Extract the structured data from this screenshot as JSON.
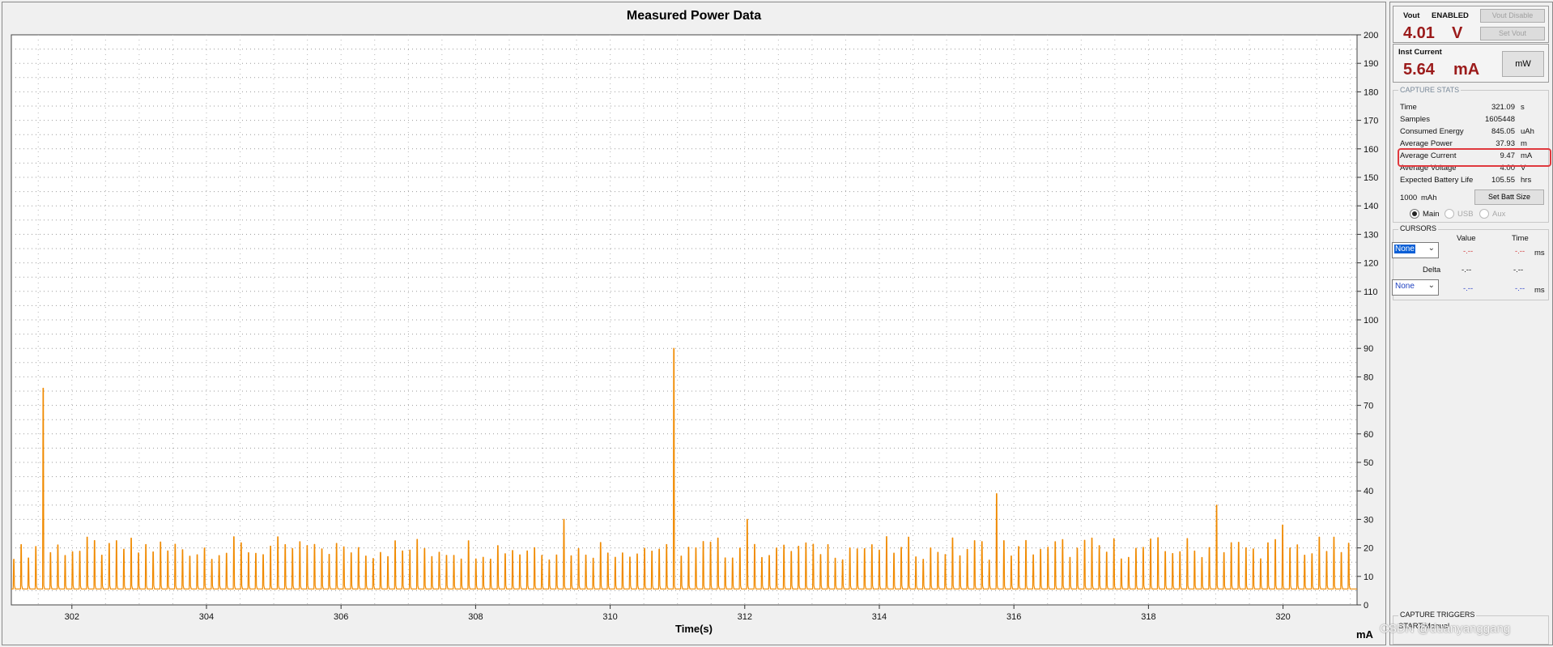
{
  "chart": {
    "title": "Measured Power Data",
    "xlabel": "Time(s)",
    "unit_label": "mA"
  },
  "chart_data": {
    "type": "line",
    "title": "Measured Power Data",
    "xlabel": "Time(s)",
    "ylabel": "mA",
    "xlim": [
      301.1,
      321.1
    ],
    "ylim": [
      0,
      200
    ],
    "x_ticks": [
      302,
      304,
      306,
      308,
      310,
      312,
      314,
      316,
      318,
      320
    ],
    "y_ticks": [
      0,
      10,
      20,
      30,
      40,
      50,
      60,
      70,
      80,
      90,
      100,
      110,
      120,
      130,
      140,
      150,
      160,
      170,
      180,
      190,
      200
    ],
    "grid": true,
    "series": [
      {
        "color": "#f08a00",
        "baseline": 5.6,
        "pulse_period_s": 0.109,
        "typical_peak": 22,
        "spikes": [
          {
            "x": 301.6,
            "y": 76
          },
          {
            "x": 309.3,
            "y": 30
          },
          {
            "x": 311.0,
            "y": 90
          },
          {
            "x": 312.0,
            "y": 30
          },
          {
            "x": 315.7,
            "y": 39
          },
          {
            "x": 319.0,
            "y": 35
          },
          {
            "x": 320.0,
            "y": 28
          }
        ]
      }
    ]
  },
  "panel": {
    "vout_label": "Vout",
    "vout_state": "ENABLED",
    "vout_disable_btn": "Vout Disable",
    "set_vout_btn": "Set Vout",
    "vout_value": "4.01",
    "vout_unit": "V",
    "inst_label": "Inst Current",
    "inst_value": "5.64",
    "inst_unit": "mA",
    "mw_btn": "mW",
    "capture_stats_title": "CAPTURE STATS",
    "stats": [
      {
        "label": "Time",
        "value": "321.09",
        "unit": "s"
      },
      {
        "label": "Samples",
        "value": "1605448",
        "unit": ""
      },
      {
        "label": "Consumed Energy",
        "value": "845.05",
        "unit": "uAh"
      },
      {
        "label": "Average Power",
        "value": "37.93",
        "unit": "m"
      },
      {
        "label": "Average Current",
        "value": "9.47",
        "unit": "mA"
      },
      {
        "label": "Average Voltage",
        "value": "4.00",
        "unit": "V"
      },
      {
        "label": "Expected Battery Life",
        "value": "105.55",
        "unit": "hrs"
      }
    ],
    "batt_size": "1000",
    "batt_unit": "mAh",
    "set_batt_btn": "Set Batt Size",
    "radio_main": "Main",
    "radio_usb": "USB",
    "radio_aux": "Aux",
    "cursors_title": "CURSORS",
    "col_value": "Value",
    "col_time": "Time",
    "cursor1_sel": "None",
    "cursor1_value": "-.--",
    "cursor1_time": "-.--",
    "cursor1_unit": "ms",
    "delta_label": "Delta",
    "delta_value": "-.--",
    "delta_time": "-.--",
    "cursor2_sel": "None",
    "cursor2_value": "-.--",
    "cursor2_time": "-.--",
    "cursor2_unit": "ms",
    "triggers_title": "CAPTURE TRIGGERS",
    "start_label": "START:",
    "start_value": "Manual"
  },
  "watermark": "CSDN @duanyanggang",
  "highlight_color": "#e0393e"
}
